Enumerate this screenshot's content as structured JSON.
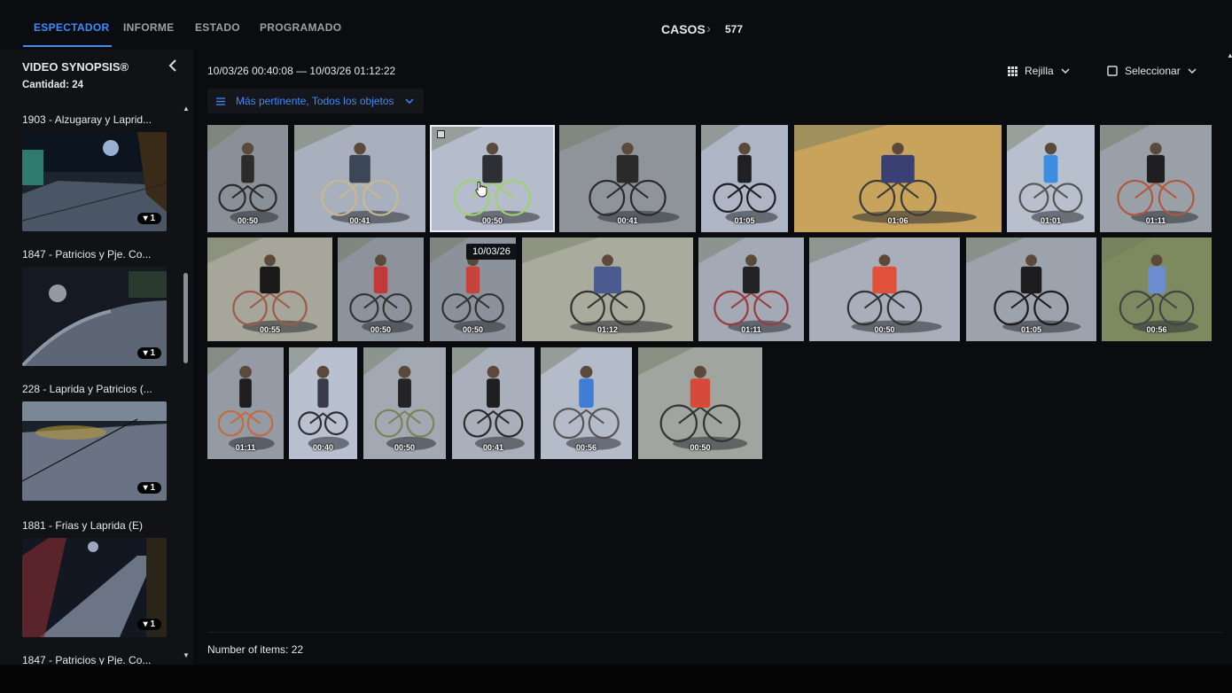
{
  "tabs": [
    {
      "label": "ESPECTADOR",
      "active": true
    },
    {
      "label": "INFORME"
    },
    {
      "label": "ESTADO"
    },
    {
      "label": "PROGRAMADO"
    }
  ],
  "breadcrumb": {
    "section": "CASOS",
    "case_id": "577"
  },
  "sidebar": {
    "title": "VIDEO SYNOPSIS®",
    "count": "Cantidad: 24",
    "cameras": [
      {
        "title": "1903 - Alzugaray y Laprid...",
        "badge": "1",
        "scene": "night-street"
      },
      {
        "title": "1847 - Patricios y Pje. Co...",
        "badge": "1",
        "scene": "curve"
      },
      {
        "title": "228 - Laprida y Patricios (...",
        "badge": "1",
        "scene": "lamp"
      },
      {
        "title": "1881 - Frias y Laprida (E)",
        "badge": "1",
        "scene": "road"
      },
      {
        "title": "1847 - Patricios y Pje. Co..."
      }
    ]
  },
  "toolbar": {
    "range": "10/03/26 00:40:08 — 10/03/26 01:12:22",
    "view_label": "Rejilla",
    "select_label": "Seleccionar",
    "sort_label": "Más pertinente, Todos los objetos"
  },
  "grid": {
    "rows": [
      [
        {
          "dur": "00:50",
          "bg": "#8a9098",
          "person": "#2b2b2b",
          "bike": "#2a2a2a"
        },
        {
          "dur": "00:41",
          "bg": "#a9b0bd",
          "person": "#3b4656",
          "bike": "#c9b98f"
        },
        {
          "dur": "00:50",
          "bg": "#b5bccb",
          "person": "#2d2f35",
          "bike": "#9fd26a",
          "selected": true
        },
        {
          "dur": "00:41",
          "bg": "#8f949b",
          "person": "#2a2a2a",
          "bike": "#2a2a2a"
        },
        {
          "dur": "01:05",
          "bg": "#aeb5c4",
          "person": "#1f1f24",
          "bike": "#1f1f24"
        },
        {
          "dur": "01:06",
          "bg": "#c7a35c",
          "person": "#3a3f74",
          "bike": "#3a3a3a"
        },
        {
          "dur": "01:01",
          "bg": "#b8bfcd",
          "person": "#3c8fe0",
          "bike": "#555"
        },
        {
          "dur": "01:11",
          "bg": "#9aa0a8",
          "person": "#1f1f22",
          "bike": "#b3563b"
        }
      ],
      [
        {
          "dur": "00:55",
          "bg": "#a6a79a",
          "person": "#1a1a1a",
          "bike": "#9b5a4a"
        },
        {
          "dur": "00:50",
          "bg": "#8d939c",
          "person": "#c2393a",
          "bike": "#333"
        },
        {
          "dur": "00:50",
          "bg": "#8c929b",
          "person": "#c8433b",
          "bike": "#333"
        },
        {
          "dur": "01:12",
          "bg": "#a9ab9d",
          "person": "#4b5b8f",
          "bike": "#333"
        },
        {
          "dur": "01:11",
          "bg": "#a3a9b5",
          "person": "#232325",
          "bike": "#9b3b3b"
        },
        {
          "dur": "00:50",
          "bg": "#a8aeba",
          "person": "#e0503a",
          "bike": "#333"
        },
        {
          "dur": "01:05",
          "bg": "#9da3ad",
          "person": "#1d1d20",
          "bike": "#1d1d20"
        },
        {
          "dur": "00:56",
          "bg": "#7d8a60",
          "person": "#6c8ed0",
          "bike": "#444"
        }
      ],
      [
        {
          "dur": "01:11",
          "bg": "#959ba5",
          "person": "#1e1e20",
          "bike": "#c46b3e"
        },
        {
          "dur": "00:40",
          "bg": "#b9c0d0",
          "person": "#3a3a48",
          "bike": "#2f2f33"
        },
        {
          "dur": "00:50",
          "bg": "#a3a9b3",
          "person": "#242427",
          "bike": "#7d8058"
        },
        {
          "dur": "00:41",
          "bg": "#aab0bb",
          "person": "#1f1f22",
          "bike": "#2a2a2a"
        },
        {
          "dur": "00:56",
          "bg": "#b4bbc9",
          "person": "#3f7ed4",
          "bike": "#555"
        },
        {
          "dur": "00:50",
          "bg": "#a0a59f",
          "person": "#d64a3a",
          "bike": "#333"
        }
      ]
    ],
    "tooltip": "10/03/26"
  },
  "footer": {
    "items": "Number of items: 22"
  },
  "colors": {
    "accent": "#3d8bfd",
    "background": "#0b0c0f",
    "sidebar": "#111215"
  }
}
